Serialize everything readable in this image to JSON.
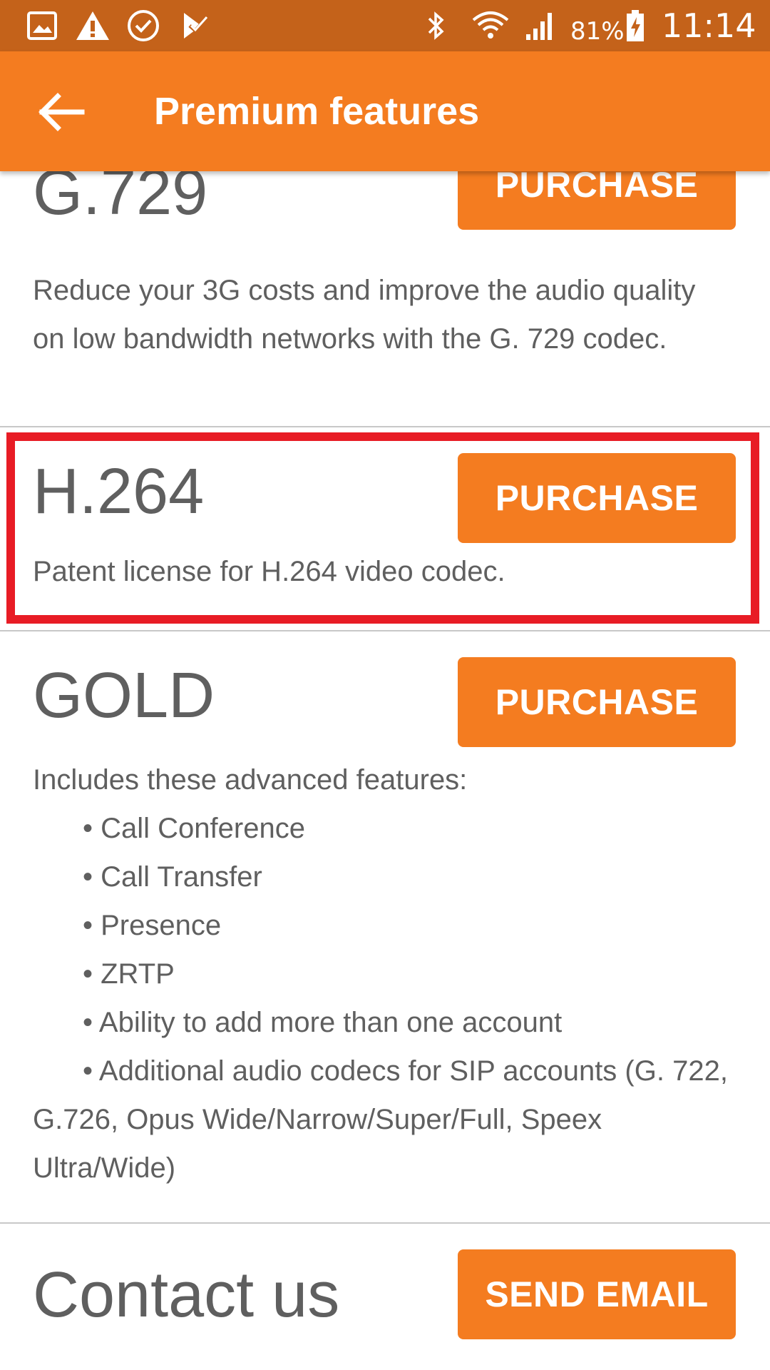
{
  "status_bar": {
    "battery": "81%",
    "time": "11:14",
    "icons": [
      "gallery-icon",
      "warning-icon",
      "check-circle-icon",
      "checkmark-icon",
      "bluetooth-icon",
      "wifi-icon",
      "signal-icon",
      "battery-charging-icon"
    ]
  },
  "app_bar": {
    "title": "Premium features",
    "back_icon": "back-arrow-icon"
  },
  "features": [
    {
      "name": "G.729",
      "button": "PURCHASE",
      "description": "Reduce your 3G costs and improve the audio quality on low bandwidth networks with the G. 729 codec."
    },
    {
      "name": "H.264",
      "button": "PURCHASE",
      "description": "Patent license for H.264 video codec."
    },
    {
      "name": "GOLD",
      "button": "PURCHASE",
      "description_intro": "Includes these advanced features:",
      "items": [
        "Call Conference",
        "Call Transfer",
        "Presence",
        "ZRTP",
        "Ability to add more than one account",
        "Additional audio codecs for SIP accounts (G. 722, G.726, Opus Wide/Narrow/Super/Full, Speex Ultra/Wide)"
      ]
    },
    {
      "name": "Contact us",
      "button": "SEND EMAIL"
    }
  ],
  "colors": {
    "status_bar": "#c4621a",
    "accent": "#f47c20",
    "highlight": "#e81c25",
    "text": "#5f5f5f"
  }
}
